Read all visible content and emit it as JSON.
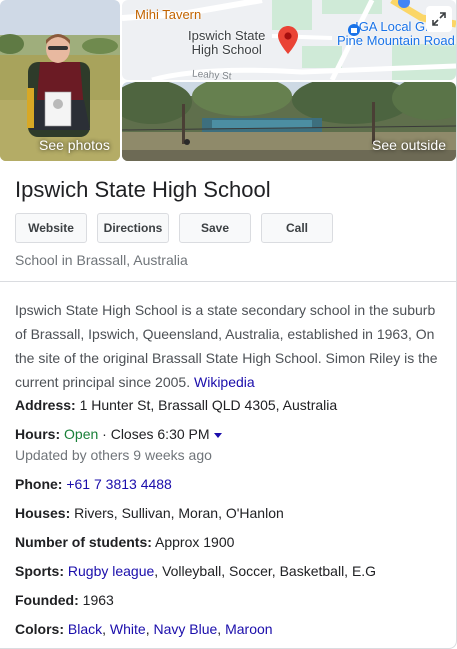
{
  "media": {
    "photos_label": "See photos",
    "outside_label": "See outside",
    "map": {
      "tavern": "Mihi Tavern",
      "school_line1": "Ipswich State",
      "school_line2": "High School",
      "iga_line1": "IGA Local Gro",
      "iga_line2": "Pine Mountain Road",
      "street": "Leahy St"
    }
  },
  "title": "Ipswich State High School",
  "actions": {
    "website": "Website",
    "directions": "Directions",
    "save": "Save",
    "call": "Call"
  },
  "subtitle": "School in Brassall, Australia",
  "description": {
    "text": "Ipswich State High School is a state secondary school in the suburb of Brassall, Ipswich, Queensland, Australia, established in 1963, On the site of the original Brassall State High School. Simon Riley is the current principal since 2005.",
    "source": "Wikipedia"
  },
  "details": {
    "address": {
      "label": "Address:",
      "value": "1 Hunter St, Brassall QLD 4305, Australia"
    },
    "hours": {
      "label": "Hours:",
      "status": "Open",
      "closes": "· Closes 6:30 PM",
      "updated": "Updated by others 9 weeks ago"
    },
    "phone": {
      "label": "Phone:",
      "value": "+61 7 3813 4488"
    },
    "houses": {
      "label": "Houses:",
      "value": "Rivers, Sullivan, Moran, O'Hanlon"
    },
    "students": {
      "label": "Number of students:",
      "value": "Approx 1900"
    },
    "sports": {
      "label": "Sports:",
      "link": "Rugby league",
      "rest": ", Volleyball, Soccer, Basketball, E.G"
    },
    "founded": {
      "label": "Founded:",
      "value": "1963"
    },
    "colors": {
      "label": "Colors:",
      "items": [
        "Black",
        "White",
        "Navy Blue",
        "Maroon"
      ],
      "sep": ", "
    }
  },
  "theme": {
    "link_color": "#1a0dab",
    "open_color": "#188038",
    "pin_color": "#ea4335"
  }
}
